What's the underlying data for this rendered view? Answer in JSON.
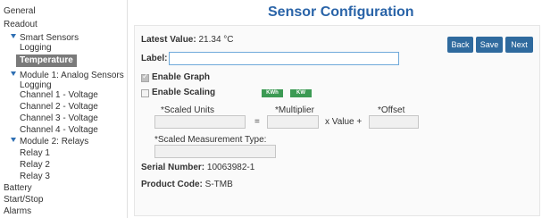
{
  "sidebar": {
    "items": [
      {
        "label": "General"
      },
      {
        "label": "Readout"
      },
      {
        "label": "Smart Sensors"
      },
      {
        "label": "Logging"
      },
      {
        "label": "Temperature"
      },
      {
        "label": "Module 1: Analog Sensors"
      },
      {
        "label": "Logging"
      },
      {
        "label": "Channel 1 - Voltage"
      },
      {
        "label": "Channel 2 - Voltage"
      },
      {
        "label": "Channel 3 - Voltage"
      },
      {
        "label": "Channel 4 - Voltage"
      },
      {
        "label": "Module 2: Relays"
      },
      {
        "label": "Relay 1"
      },
      {
        "label": "Relay 2"
      },
      {
        "label": "Relay 3"
      },
      {
        "label": "Battery"
      },
      {
        "label": "Start/Stop"
      },
      {
        "label": "Alarms"
      }
    ]
  },
  "main": {
    "title": "Sensor Configuration",
    "latest_value_label": "Latest Value:",
    "latest_value": "21.34 °C",
    "label_field_label": "Label:",
    "label_field_value": "",
    "buttons": {
      "back": "Back",
      "save": "Save",
      "next": "Next"
    },
    "enable_graph": {
      "label": "Enable Graph",
      "checked": true
    },
    "enable_scaling": {
      "label": "Enable Scaling",
      "checked": false
    },
    "badges": {
      "kwh": "KWh",
      "kw": "KW"
    },
    "scaled_units_label": "*Scaled Units",
    "multiplier_label": "*Multiplier",
    "offset_label": "*Offset",
    "equals_sign": "=",
    "x_value_plus": "x Value +",
    "scaled_measurement_type_label": "*Scaled Measurement Type:",
    "serial_number_label": "Serial Number:",
    "serial_number": "10063982-1",
    "product_code_label": "Product Code:",
    "product_code": "S-TMB"
  },
  "colors": {
    "accent": "#2a64a8",
    "button": "#2f6a9e",
    "badge": "#3c9a54",
    "active_nav": "#7a7a7a"
  }
}
